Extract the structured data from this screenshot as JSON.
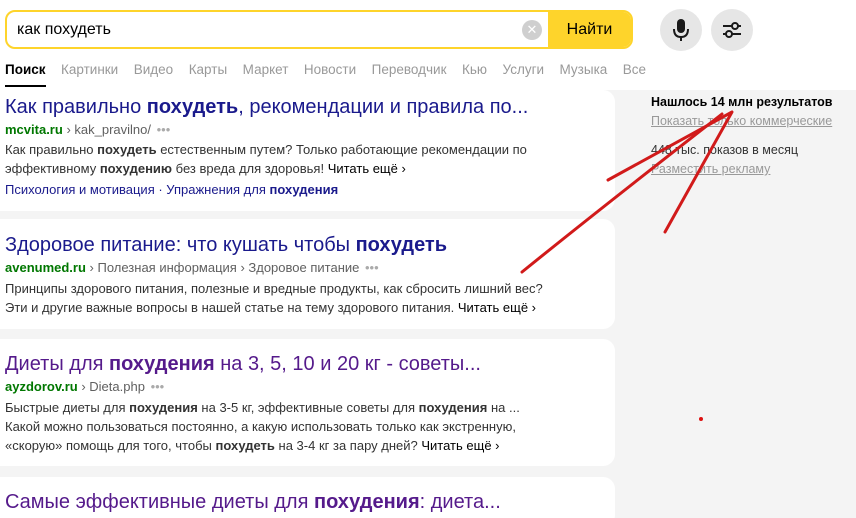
{
  "search": {
    "query": "как похудеть",
    "button_label": "Найти",
    "clear_symbol": "✕"
  },
  "tabs": [
    {
      "label": "Поиск",
      "active": true
    },
    {
      "label": "Картинки"
    },
    {
      "label": "Видео"
    },
    {
      "label": "Карты"
    },
    {
      "label": "Маркет"
    },
    {
      "label": "Новости"
    },
    {
      "label": "Переводчик"
    },
    {
      "label": "Кью"
    },
    {
      "label": "Услуги"
    },
    {
      "label": "Музыка"
    },
    {
      "label": "Все"
    }
  ],
  "results": [
    {
      "title_pre": "Как правильно ",
      "title_bold": "похудеть",
      "title_post": ", рекомендации и правила по...",
      "domain": "mcvita.ru",
      "path": "› kak_pravilno/",
      "dots": "•••",
      "snippet1_a": "Как правильно ",
      "snippet1_b": "похудеть",
      "snippet1_c": " естественным путем? Только работающие рекомендации по",
      "snippet2_a": "эффективному ",
      "snippet2_b": "похудению",
      "snippet2_c": " без вреда для здоровья! ",
      "more": "Читать ещё ›",
      "sitelink1": "Психология и мотивация",
      "sitelink_sep": " · ",
      "sitelink2_a": "Упражнения для ",
      "sitelink2_b": "похудения"
    },
    {
      "title_pre": "Здоровое питание: что кушать чтобы ",
      "title_bold": "похудеть",
      "title_post": "",
      "domain": "avenumed.ru",
      "path": "› Полезная информация › Здоровое питание",
      "dots": "•••",
      "snippet1": "Принципы здорового питания, полезные и вредные продукты, как сбросить лишний вес?",
      "snippet2": "Эти и другие важные вопросы в нашей статье на тему здорового питания. ",
      "more": "Читать ещё ›"
    },
    {
      "title_pre": "Диеты для ",
      "title_bold": "похудения",
      "title_post": " на 3, 5, 10 и 20 кг - советы...",
      "domain": "ayzdorov.ru",
      "path": "› Dieta.php",
      "dots": "•••",
      "snippet1_a": "Быстрые диеты для ",
      "snippet1_b": "похудения",
      "snippet1_c": " на 3-5 кг, эффективные советы для ",
      "snippet1_d": "похудения",
      "snippet1_e": " на ...",
      "snippet2": "Какой можно пользоваться постоянно, а какую использовать только как экстренную,",
      "snippet3_a": "«скорую» помощь для того, чтобы ",
      "snippet3_b": "похудеть",
      "snippet3_c": " на 3-4 кг за пару дней? ",
      "more": "Читать ещё ›"
    },
    {
      "title_pre": "Самые эффективные диеты для ",
      "title_bold": "похудения",
      "title_post": ": диета..."
    }
  ],
  "aside": {
    "found": "Нашлось 14 млн результатов",
    "commercial_link": "Показать только коммерческие",
    "impressions": "448 тыс. показов в месяц",
    "ad_link": "Разместить рекламу"
  },
  "colors": {
    "accent": "#fed42b",
    "link": "#1a1a8c",
    "visited": "#551a8b",
    "domain": "#007700",
    "annotation": "#d11a1a"
  },
  "icons": [
    "clear-icon",
    "microphone-icon",
    "filters-icon",
    "chevron-right-icon"
  ]
}
